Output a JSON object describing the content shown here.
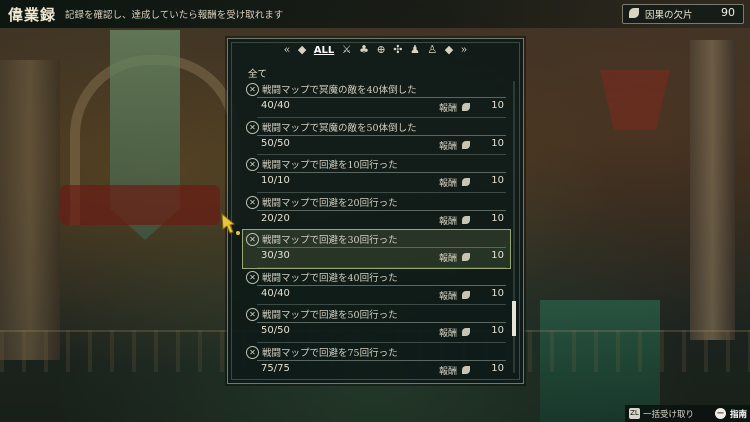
{
  "header": {
    "title": "偉業録",
    "subtitle": "記録を確認し、達成していたら報酬を受け取れます"
  },
  "currency": {
    "label": "因果の欠片",
    "value": "90"
  },
  "filter_tabs": {
    "active_label": "ALL"
  },
  "category_label": "全て",
  "achievements": [
    {
      "name": "戦闘マップで冥魔の敵を40体倒した",
      "progress": "40/40",
      "reward_label": "報酬",
      "reward": "10"
    },
    {
      "name": "戦闘マップで冥魔の敵を50体倒した",
      "progress": "50/50",
      "reward_label": "報酬",
      "reward": "10"
    },
    {
      "name": "戦闘マップで回避を10回行った",
      "progress": "10/10",
      "reward_label": "報酬",
      "reward": "10"
    },
    {
      "name": "戦闘マップで回避を20回行った",
      "progress": "20/20",
      "reward_label": "報酬",
      "reward": "10"
    },
    {
      "name": "戦闘マップで回避を30回行った",
      "progress": "30/30",
      "reward_label": "報酬",
      "reward": "10"
    },
    {
      "name": "戦闘マップで回避を40回行った",
      "progress": "40/40",
      "reward_label": "報酬",
      "reward": "10"
    },
    {
      "name": "戦闘マップで回避を50回行った",
      "progress": "50/50",
      "reward_label": "報酬",
      "reward": "10"
    },
    {
      "name": "戦闘マップで回避を75回行った",
      "progress": "75/75",
      "reward_label": "報酬",
      "reward": "10"
    }
  ],
  "bottom_bar": {
    "claim_all_key": "ZL",
    "claim_all_label": "一括受け取り",
    "guide_key": "−",
    "guide_label": "指南"
  }
}
